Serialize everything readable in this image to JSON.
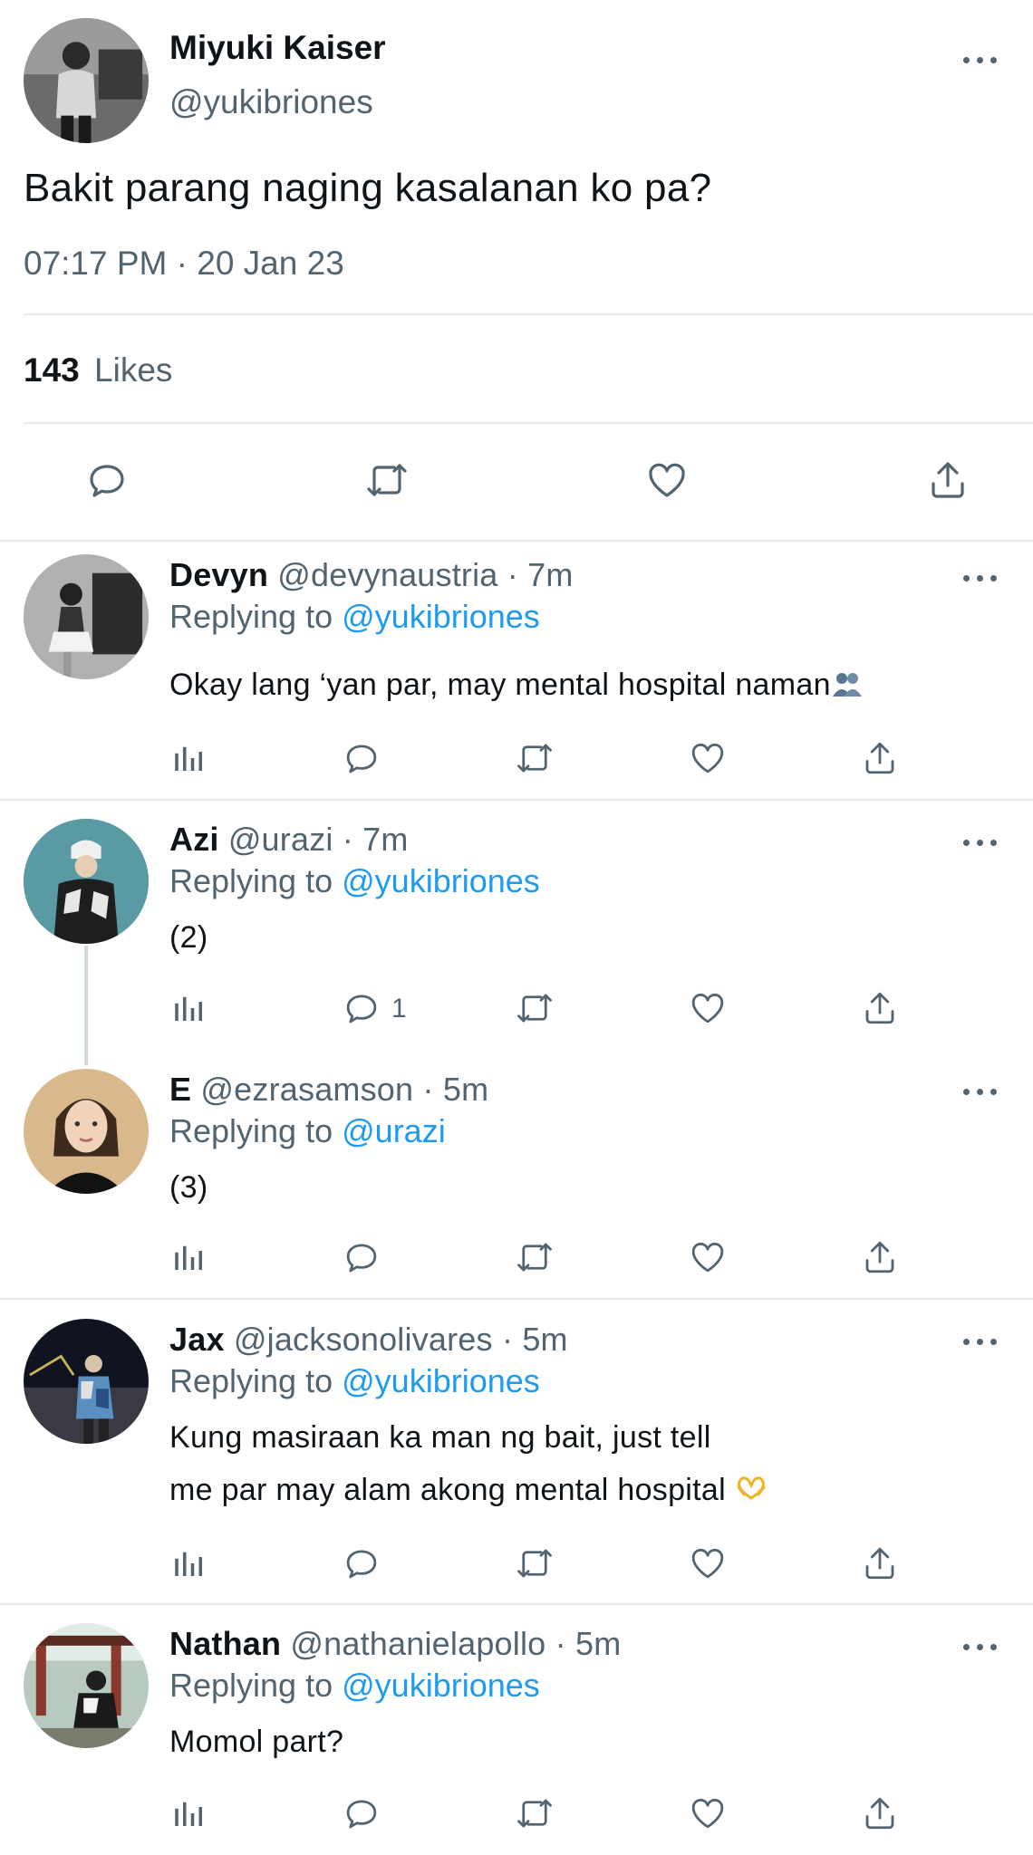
{
  "main_tweet": {
    "display_name": "Miyuki Kaiser",
    "handle": "@yukibriones",
    "text": "Bakit parang naging kasalanan ko pa?",
    "timestamp": "07:17 PM · 20 Jan 23",
    "likes_count": "143",
    "likes_label": "Likes"
  },
  "replies": [
    {
      "display_name": "Devyn",
      "handle": "@devynaustria",
      "time": "· 7m",
      "replying_prefix": "Replying to",
      "replying_to": "@yukibriones",
      "text": "Okay lang ‘yan par, may mental hospital naman",
      "reply_count": ""
    },
    {
      "display_name": "Azi",
      "handle": "@urazi",
      "time": "· 7m",
      "replying_prefix": "Replying to",
      "replying_to": "@yukibriones",
      "text": "(2)",
      "reply_count": "1"
    },
    {
      "display_name": "E",
      "handle": "@ezrasamson",
      "time": "· 5m",
      "replying_prefix": "Replying to",
      "replying_to": "@urazi",
      "text": "(3)",
      "reply_count": ""
    },
    {
      "display_name": "Jax",
      "handle": "@jacksonolivares",
      "time": "· 5m",
      "replying_prefix": "Replying to",
      "replying_to": "@yukibriones",
      "text_line1": "Kung masiraan ka man ng bait, just tell",
      "text_line2": "me par may alam akong mental hospital",
      "reply_count": ""
    },
    {
      "display_name": "Nathan",
      "handle": "@nathanielapollo",
      "time": "· 5m",
      "replying_prefix": "Replying to",
      "replying_to": "@yukibriones",
      "text": "Momol part?",
      "reply_count": ""
    }
  ],
  "icons": [
    "more-icon",
    "reply-icon",
    "retweet-icon",
    "like-icon",
    "share-icon",
    "analytics-icon",
    "people-emoji-icon",
    "heart-hands-emoji-icon"
  ],
  "colors": {
    "text": "#0f1419",
    "secondary": "#536471",
    "link": "#1d9bf0",
    "divider": "#e7e9eb"
  }
}
